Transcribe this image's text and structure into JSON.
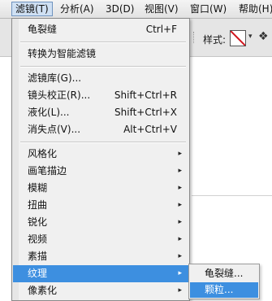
{
  "menubar": {
    "items": [
      {
        "label": "滤镜(T)",
        "active": true
      },
      {
        "label": "分析(A)"
      },
      {
        "label": "3D(D)"
      },
      {
        "label": "视图(V)"
      },
      {
        "label": "窗口(W)"
      },
      {
        "label": "帮助(H)"
      }
    ]
  },
  "options_bar": {
    "style_label": "样式:",
    "style_swatch_icon": "no-style-icon",
    "dropdown_arrow": "▾",
    "tool_icon": "❖"
  },
  "filter_menu": {
    "items": [
      {
        "label": "龟裂缝",
        "shortcut": "Ctrl+F"
      },
      {
        "label": "转换为智能滤镜"
      },
      {
        "label": "滤镜库(G)..."
      },
      {
        "label": "镜头校正(R)...",
        "shortcut": "Shift+Ctrl+R"
      },
      {
        "label": "液化(L)...",
        "shortcut": "Shift+Ctrl+X"
      },
      {
        "label": "消失点(V)...",
        "shortcut": "Alt+Ctrl+V"
      },
      {
        "label": "风格化",
        "submenu": true
      },
      {
        "label": "画笔描边",
        "submenu": true
      },
      {
        "label": "模糊",
        "submenu": true
      },
      {
        "label": "扭曲",
        "submenu": true
      },
      {
        "label": "锐化",
        "submenu": true
      },
      {
        "label": "视频",
        "submenu": true
      },
      {
        "label": "素描",
        "submenu": true
      },
      {
        "label": "纹理",
        "submenu": true,
        "highlighted": true
      },
      {
        "label": "像素化",
        "submenu": true
      }
    ],
    "submenu_arrow": "▸"
  },
  "texture_submenu": {
    "items": [
      {
        "label": "龟裂缝..."
      },
      {
        "label": "颗粒...",
        "highlighted": true
      }
    ]
  },
  "colors": {
    "highlight": "#3d8fe0",
    "menu_bg": "#f0f0f0",
    "no_style_red": "#d0141c"
  }
}
